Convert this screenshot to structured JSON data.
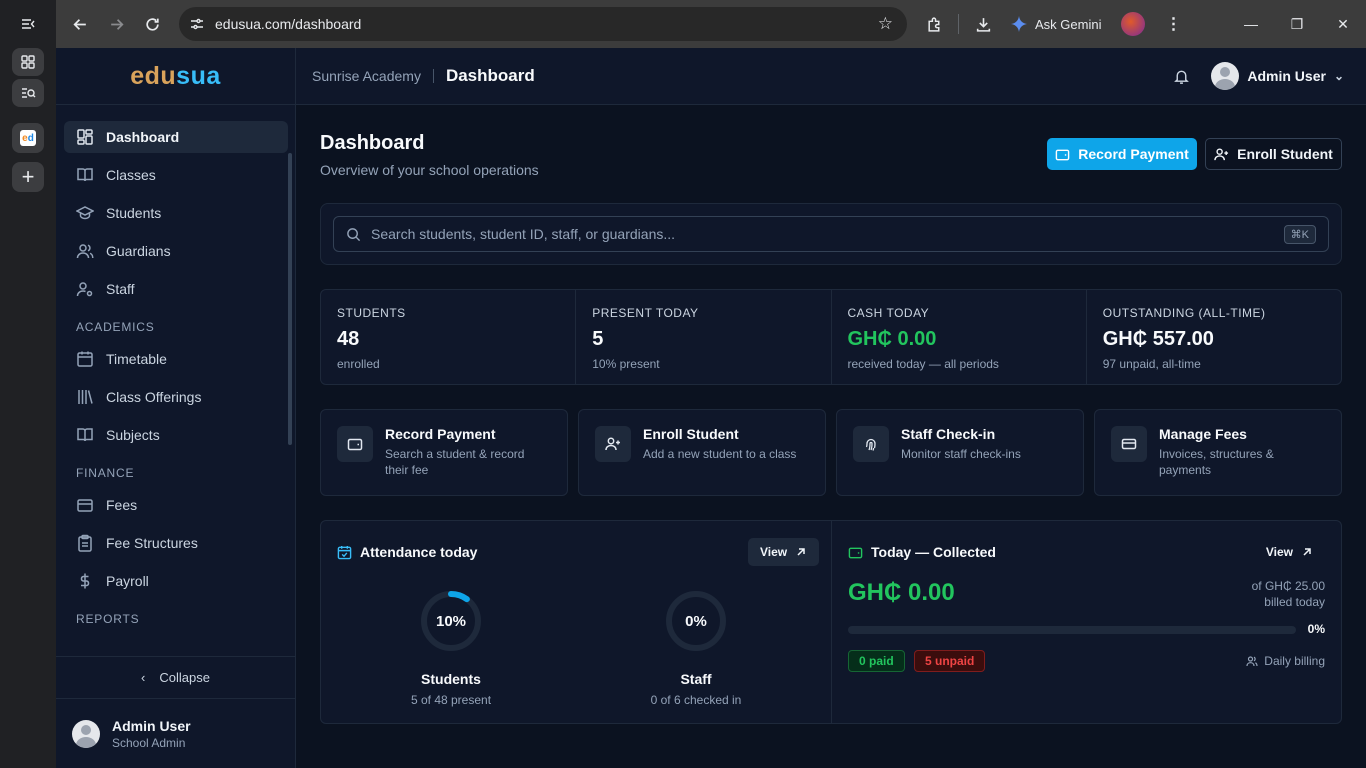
{
  "browser": {
    "url": "edusua.com/dashboard",
    "ask_gemini": "Ask Gemini",
    "tab_favicon": "ed"
  },
  "app": {
    "logo_part1": "edu",
    "logo_part2": "sua",
    "school": "Sunrise Academy",
    "page": "Dashboard",
    "user_name": "Admin User",
    "user_role": "School Admin",
    "collapse": "Collapse"
  },
  "sidebar": {
    "items": [
      {
        "label": "Dashboard",
        "icon": "dashboard-icon"
      },
      {
        "label": "Classes",
        "icon": "book-open-icon"
      },
      {
        "label": "Students",
        "icon": "graduation-cap-icon"
      },
      {
        "label": "Guardians",
        "icon": "users-icon"
      },
      {
        "label": "Staff",
        "icon": "user-cog-icon"
      }
    ],
    "section_academics": "ACADEMICS",
    "academics": [
      {
        "label": "Timetable",
        "icon": "calendar-icon"
      },
      {
        "label": "Class Offerings",
        "icon": "library-icon"
      },
      {
        "label": "Subjects",
        "icon": "book-open-icon"
      }
    ],
    "section_finance": "FINANCE",
    "finance": [
      {
        "label": "Fees",
        "icon": "wallet-icon"
      },
      {
        "label": "Fee Structures",
        "icon": "clipboard-icon"
      },
      {
        "label": "Payroll",
        "icon": "dollar-icon"
      }
    ],
    "section_reports": "REPORTS"
  },
  "header": {
    "title": "Dashboard",
    "subtitle": "Overview of your school operations",
    "record_payment": "Record Payment",
    "enroll_student": "Enroll Student"
  },
  "search": {
    "placeholder": "Search students, student ID, staff, or guardians...",
    "shortcut": "⌘K"
  },
  "stats": [
    {
      "label": "STUDENTS",
      "value": "48",
      "note": "enrolled"
    },
    {
      "label": "PRESENT TODAY",
      "value": "5",
      "note": "10% present"
    },
    {
      "label": "CASH TODAY",
      "value": "GH₵ 0.00",
      "note": "received today — all periods"
    },
    {
      "label": "OUTSTANDING (ALL-TIME)",
      "value": "GH₵ 557.00",
      "note": "97 unpaid, all-time"
    }
  ],
  "actions": [
    {
      "title": "Record Payment",
      "desc": "Search a student & record their fee",
      "icon": "wallet-icon"
    },
    {
      "title": "Enroll Student",
      "desc": "Add a new student to a class",
      "icon": "user-plus-icon"
    },
    {
      "title": "Staff Check-in",
      "desc": "Monitor staff check-ins",
      "icon": "fingerprint-icon"
    },
    {
      "title": "Manage Fees",
      "desc": "Invoices, structures & payments",
      "icon": "credit-card-icon"
    }
  ],
  "attendance": {
    "title": "Attendance today",
    "view": "View",
    "students_pct_label": "10%",
    "students_pct": 10,
    "students_title": "Students",
    "students_note": "5 of 48 present",
    "staff_pct_label": "0%",
    "staff_pct": 0,
    "staff_title": "Staff",
    "staff_note": "0 of 6 checked in"
  },
  "collected": {
    "title": "Today — Collected",
    "view": "View",
    "amount": "GH₵ 0.00",
    "billed_line1": "of GH₵ 25.00",
    "billed_line2": "billed today",
    "progress": 0,
    "pct_label": "0%",
    "paid": "0 paid",
    "unpaid": "5 unpaid",
    "billing": "Daily billing"
  },
  "colors": {
    "accent": "#0ea5e9",
    "success": "#22c55e",
    "danger": "#ef4444",
    "bg": "#0b1220",
    "surface": "#0f172a"
  }
}
